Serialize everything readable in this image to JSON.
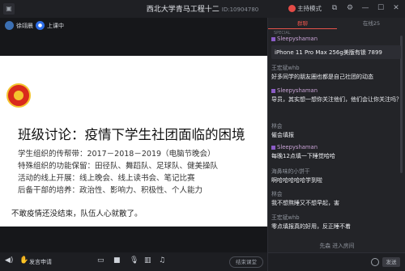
{
  "window": {
    "title": "西北大学青马工程十二",
    "room_id": "ID:10904780",
    "mode_label": "主持模式",
    "controls": [
      "minimize-icon",
      "maximize-icon",
      "close-icon"
    ]
  },
  "stage": {
    "users": [
      {
        "name": "徐翊晨"
      },
      {
        "name": "上课中"
      }
    ]
  },
  "slide": {
    "title": "班级讨论：疫情下学生社团面临的困境",
    "lines": [
      "学生组织的传帮带：2017－2018－2019（电脑节晚会）",
      "特殊组织的功能保留：田径队、舞蹈队、足球队、健美操队",
      "活动的线上开展：线上晚会、线上读书会、笔记比赛",
      "后备干部的培养：政治性、影响力、积极性、个人能力"
    ],
    "footer": "不敢疫情还没结束，队伍人心就散了。"
  },
  "bottombar": {
    "apply_label": "发言申请",
    "end_label": "结束课堂",
    "icons": [
      "volume-icon",
      "mic-icon",
      "screen-share-icon",
      "camera-icon",
      "mic-toggle-icon",
      "chart-icon",
      "music-icon"
    ]
  },
  "chat_panel": {
    "tabs": [
      {
        "label": "群聊",
        "active": true
      },
      {
        "label": "在线25",
        "active": false
      }
    ],
    "special_label": "SPECIAL",
    "first_message": "iPhone 11 Pro Max 256g美版有锁 7899",
    "messages": [
      {
        "author": "王宏斌whb",
        "text": "好多同学的朋友圈也都是自己社团的动态",
        "highlight": false
      },
      {
        "author": "Sleepyshaman",
        "text": "导员，其实想一想你关注他们，他们会让你关注吗？",
        "highlight": true
      },
      {
        "author": "林会",
        "text": "催会填报",
        "highlight": false
      },
      {
        "author": "Sleepyshaman",
        "text": "每晚12点填一下睡觉哈哈",
        "highlight": true
      },
      {
        "author": "海鼻味的小饼干",
        "text": "啊哈哈哈哈哈学到啦",
        "highlight": false
      },
      {
        "author": "林会",
        "text": "我不想熬睡又不想早起，害",
        "highlight": false
      },
      {
        "author": "王宏斌whb",
        "text": "零点填报真的好用，反正睡不着",
        "highlight": false
      }
    ],
    "join_notice": "先森 进入房间",
    "send_label": "发送"
  }
}
